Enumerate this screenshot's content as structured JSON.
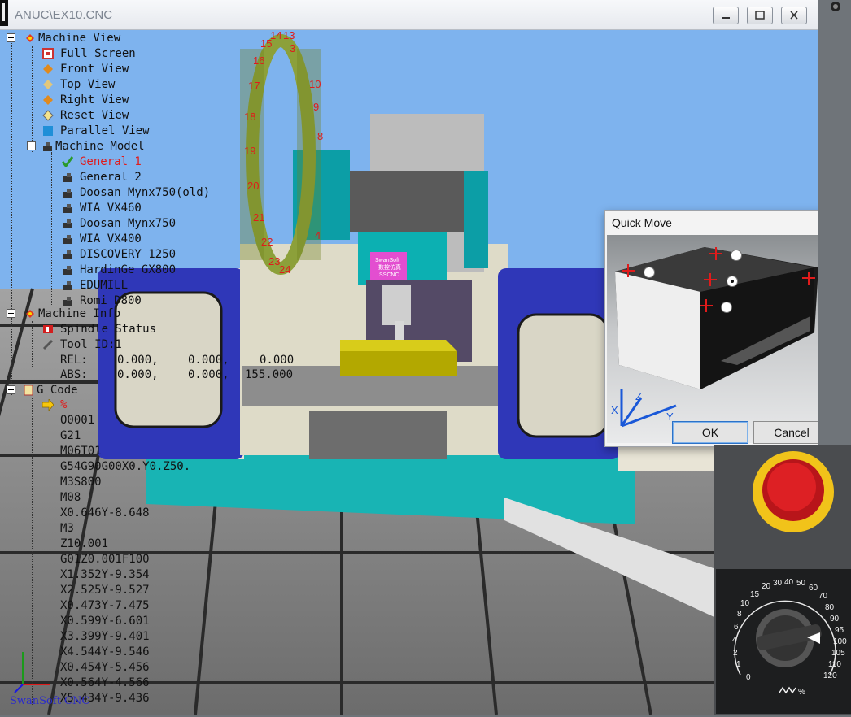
{
  "window": {
    "title": "ANUC\\EX10.CNC"
  },
  "tree": {
    "machine_view": {
      "label": "Machine View",
      "items": [
        "Full Screen",
        "Front View",
        "Top View",
        "Right View",
        "Reset View",
        "Parallel View"
      ]
    },
    "machine_model": {
      "label": "Machine Model",
      "items": [
        "General 1",
        "General 2",
        "Doosan Mynx750(old)",
        "WIA VX460",
        "Doosan Mynx750",
        "WIA VX400",
        "DISCOVERY 1250",
        "HardinGe GX800",
        "EDUMILL",
        "Romi D800"
      ],
      "selected": "General 1"
    },
    "machine_info": {
      "label": "Machine Info",
      "spindle": "Spindle Status",
      "tool": "Tool ID:1",
      "rel": {
        "label": "REL:",
        "x": "0.000,",
        "y": "0.000,",
        "z": "0.000"
      },
      "abs": {
        "label": "ABS:",
        "x": "0.000,",
        "y": "0.000,",
        "z": "155.000"
      }
    },
    "g_code": {
      "label": "G Code",
      "first": "%",
      "lines": [
        "O0001",
        "G21",
        "M06T01",
        "G54G90G00X0.Y0.Z50.",
        "M3S800",
        "M08",
        "X0.646Y-8.648",
        "M3",
        "Z10.001",
        "G01Z0.001F100",
        "X1.352Y-9.354",
        "X2.525Y-9.527",
        "X0.473Y-7.475",
        "X0.599Y-6.601",
        "X3.399Y-9.401",
        "X4.544Y-9.546",
        "X0.454Y-5.456",
        "X0.564Y-4.566",
        "X5.434Y-9.436"
      ]
    }
  },
  "scene": {
    "carousel_numbers": [
      "14",
      "13",
      "15",
      "16",
      "17",
      "18",
      "19",
      "20",
      "21",
      "22",
      "23",
      "24",
      "9",
      "10",
      "8",
      "4",
      "3"
    ],
    "spindle_label": [
      "SwanSoft",
      "数控仿真",
      "SSCNC"
    ],
    "logo": "SwanSoft CNC"
  },
  "quick_move": {
    "title": "Quick Move",
    "close": "✕",
    "ok": "OK",
    "cancel": "Cancel",
    "axes": [
      "X",
      "Y",
      "Z"
    ]
  },
  "dial": {
    "ticks": [
      "0",
      "1",
      "2",
      "4",
      "6",
      "8",
      "10",
      "15",
      "20",
      "30",
      "40",
      "50",
      "60",
      "70",
      "80",
      "90",
      "95",
      "100",
      "105",
      "110",
      "120"
    ],
    "unit": "%"
  },
  "colors": {
    "sky": "#7eb3ee",
    "floor": "#8c8c8c",
    "machine_blue": "#2f37b8",
    "teal": "#0aa8a8",
    "selected": "#e01b1b"
  },
  "icons": [
    "machine-view-icon",
    "full-screen-icon",
    "front-view-icon",
    "top-view-icon",
    "right-view-icon",
    "reset-view-icon",
    "parallel-view-icon",
    "machine-model-icon",
    "checkmark-icon",
    "machine-info-icon",
    "spindle-icon",
    "tool-icon",
    "gcode-icon",
    "current-line-arrow-icon",
    "close-icon",
    "emergency-stop-icon",
    "feed-override-dial-icon"
  ]
}
